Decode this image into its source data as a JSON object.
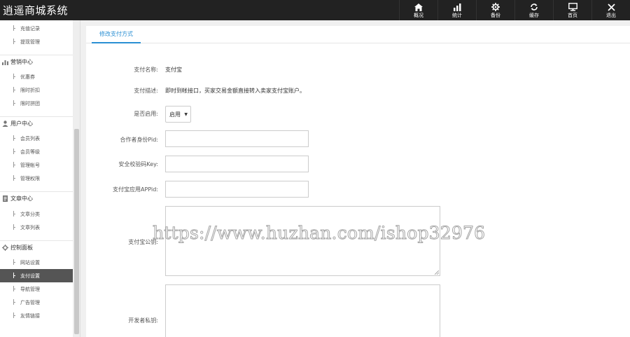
{
  "app": {
    "title": "逍遥商城系统"
  },
  "topnav": [
    {
      "label": "概况",
      "icon": "home-icon"
    },
    {
      "label": "统计",
      "icon": "bar-chart-icon"
    },
    {
      "label": "备份",
      "icon": "gear-icon"
    },
    {
      "label": "缓存",
      "icon": "refresh-icon"
    },
    {
      "label": "首页",
      "icon": "monitor-icon"
    },
    {
      "label": "退出",
      "icon": "close-icon"
    }
  ],
  "sidebar": {
    "top_items": [
      "充值记录",
      "提现管理"
    ],
    "groups": [
      {
        "label": "营销中心",
        "icon": "chart-icon",
        "items": [
          "优惠券",
          "限时折扣",
          "限时拼团"
        ]
      },
      {
        "label": "用户中心",
        "icon": "user-icon",
        "items": [
          "会员列表",
          "会员等级",
          "管理帐号",
          "管理权限"
        ]
      },
      {
        "label": "文章中心",
        "icon": "document-icon",
        "items": [
          "文章分类",
          "文章列表"
        ]
      },
      {
        "label": "控制面板",
        "icon": "gear-icon",
        "items": [
          "网站设置",
          "支付设置",
          "导航管理",
          "广告管理",
          "友情链接"
        ]
      }
    ],
    "active_item": "支付设置"
  },
  "main": {
    "tab": "修改支付方式",
    "form": {
      "name_label": "支付名称:",
      "name_value": "支付宝",
      "desc_label": "支付描述:",
      "desc_value": "即时到帐接口，买家交易金额直接转入卖家支付宝账户。",
      "enabled_label": "是否启用:",
      "enabled_value": "启用",
      "pid_label": "合作者身份Pid:",
      "key_label": "安全校验码Key:",
      "appid_label": "支付宝应用APPid:",
      "pubkey_label": "支付宝公钥:",
      "privkey_label": "开发者私钥:"
    }
  },
  "watermark": "https://www.huzhan.com/ishop32976"
}
